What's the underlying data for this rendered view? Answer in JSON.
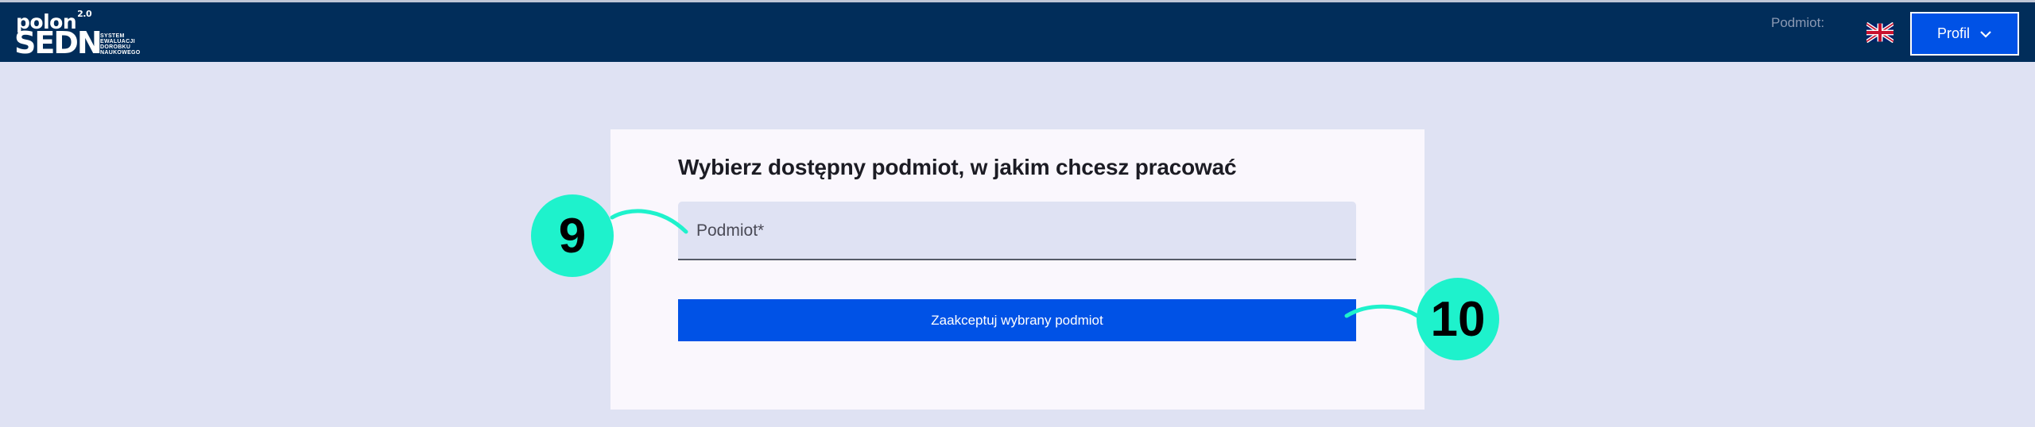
{
  "header": {
    "logo_polon": "polon",
    "logo_version": "2.0",
    "logo_sedn": "SEDN",
    "logo_subtitle_lines": [
      "SYSTEM",
      "EWALUACJI",
      "DOROBKU",
      "NAUKOWEGO"
    ],
    "podmiot_label": "Podmiot:",
    "language_flag": "uk-flag-icon",
    "profile_button_label": "Profil",
    "profile_chevron": "chevron-down-icon"
  },
  "main": {
    "title": "Wybierz dostępny podmiot, w jakim chcesz pracować",
    "podmiot_field": {
      "placeholder": "Podmiot*",
      "value": ""
    },
    "accept_button_label": "Zaakceptuj wybrany podmiot"
  },
  "annotations": {
    "marker_field": "9",
    "marker_button": "10",
    "marker_color": "#1ef2cc"
  },
  "colors": {
    "header_bg": "#012d5a",
    "page_bg": "#dfe2f3",
    "primary": "#0052e6"
  }
}
